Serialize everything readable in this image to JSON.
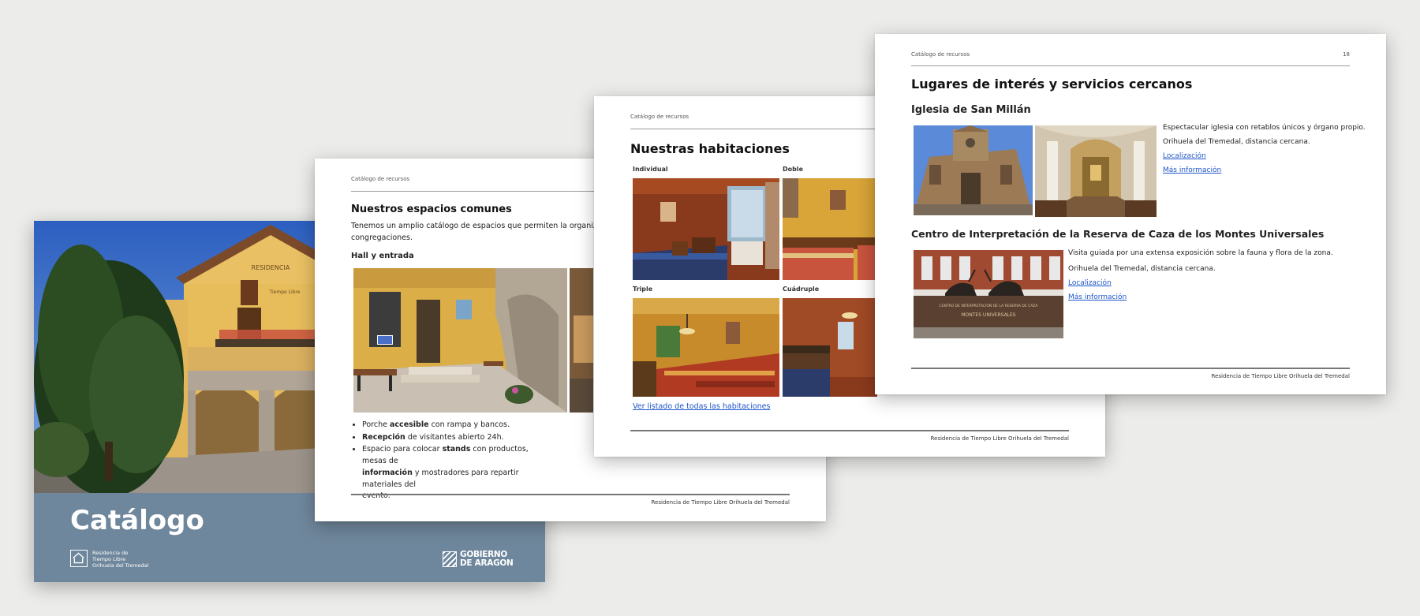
{
  "cover": {
    "title": "Catálogo",
    "facade_sign_top": "RESIDENCIA",
    "facade_sign_bottom": "Tiempo Libre",
    "residence_brand": [
      "Residencia de",
      "Tiempo Libre",
      "Orihuela del Tremedal"
    ],
    "gov_brand": [
      "GOBIERNO",
      "DE ARAGON"
    ],
    "band_color": "#6f879c"
  },
  "common": {
    "header": "Catálogo de recursos",
    "footer": "Residencia de Tiempo Libre Orihuela del Tremedal"
  },
  "page_spaces": {
    "title": "Nuestros espacios comunes",
    "intro": [
      "Tenemos un amplio catálogo de espacios que permiten la organización de je",
      "congregaciones."
    ],
    "section": "Hall y entrada",
    "bullets": [
      {
        "pre": "Porche ",
        "bold": "accesible",
        "post": " con rampa y bancos."
      },
      {
        "pre": "",
        "bold": "Recepción",
        "post": " de visitantes abierto 24h."
      },
      {
        "pre": "Espacio para colocar ",
        "bold": "stands",
        "post": " con productos, mesas de "
      },
      {
        "pre": "",
        "bold": "información",
        "post": " y mostradores para repartir materiales del"
      },
      {
        "pre": "evento.",
        "bold": "",
        "post": ""
      }
    ]
  },
  "page_rooms": {
    "title": "Nuestras habitaciones",
    "rooms": [
      "Individual",
      "Doble",
      "Triple",
      "Cuádruple"
    ],
    "link": "Ver listado de todas las habitaciones"
  },
  "page_places": {
    "page_number": "18",
    "title": "Lugares de interés y servicios cercanos",
    "places": [
      {
        "name": "Iglesia de San Millán",
        "description": "Espectacular iglesia con retablos únicos y órgano propio.",
        "location": "Orihuela del Tremedal, distancia cercana.",
        "link_location": "Localización",
        "link_info": "Más información"
      },
      {
        "name": "Centro de Interpretación de la Reserva de Caza de los Montes Universales",
        "description": "Visita guiada por una extensa exposición sobre la fauna y flora de la zona.",
        "location": "Orihuela del Tremedal, distancia cercana.",
        "link_location": "Localización",
        "link_info": "Más información",
        "sign_text_1": "CENTRO DE INTERPRETACIÓN DE LA RESERVA DE CAZA",
        "sign_text_2": "MONTES UNIVERSALES"
      }
    ]
  }
}
